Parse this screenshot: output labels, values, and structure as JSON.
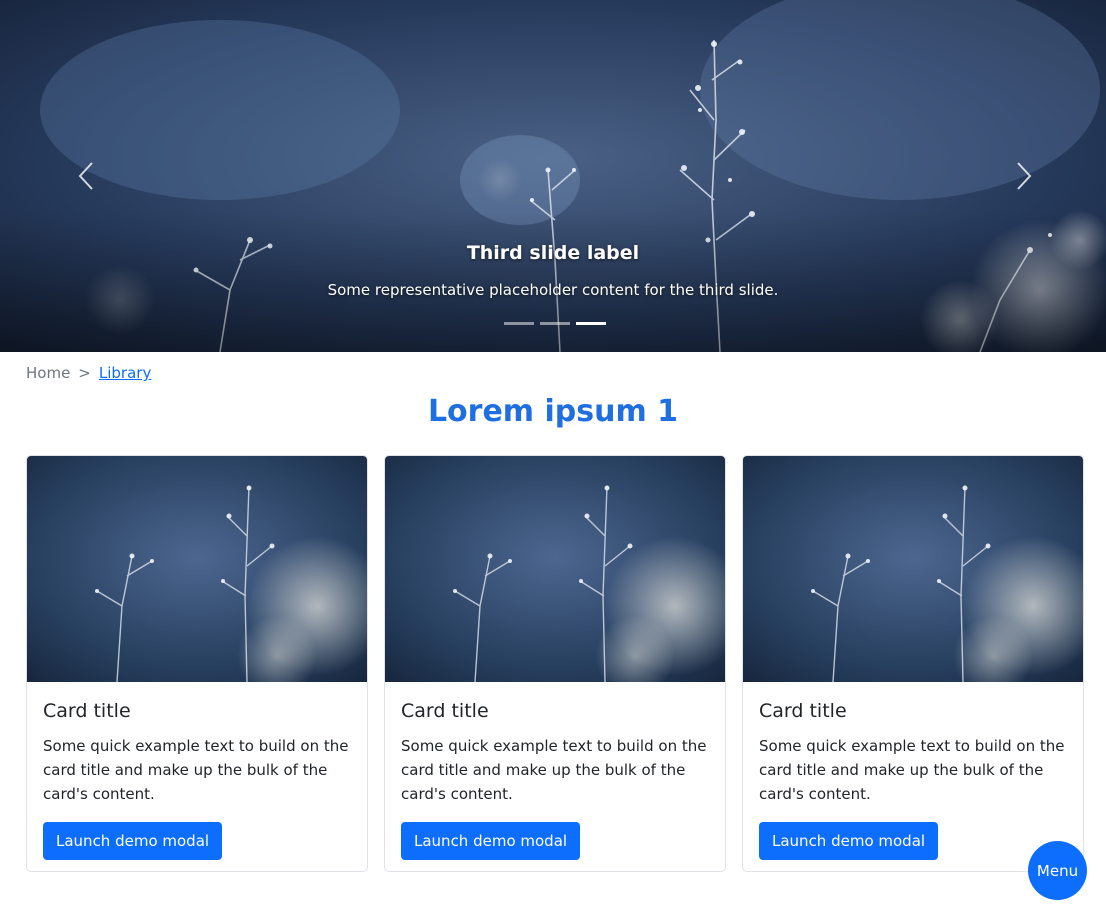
{
  "carousel": {
    "image": "frosted-plants-photo",
    "caption_title": "Third slide label",
    "caption_text": "Some representative placeholder content for the third slide.",
    "prev_icon": "chevron-left-icon",
    "next_icon": "chevron-right-icon",
    "slide_count": 3,
    "active_slide": 3
  },
  "breadcrumb": {
    "items": [
      {
        "label": "Home"
      },
      {
        "label": ">"
      },
      {
        "label": "Library"
      }
    ]
  },
  "main": {
    "title": "Lorem ipsum 1"
  },
  "cards": [
    {
      "image": "frosted-plants-photo",
      "title": "Card title",
      "text": "Some quick example text to build on the card title and make up the bulk of the card's content.",
      "button_label": "Launch demo modal"
    },
    {
      "image": "frosted-plants-photo",
      "title": "Card title",
      "text": "Some quick example text to build on the card title and make up the bulk of the card's content.",
      "button_label": "Launch demo modal"
    },
    {
      "image": "frosted-plants-photo",
      "title": "Card title",
      "text": "Some quick example text to build on the card title and make up the bulk of the card's content.",
      "button_label": "Launch demo modal"
    }
  ],
  "fab": {
    "label": "Menu"
  },
  "colors": {
    "primary": "#0d6efd",
    "title": "#1f6fe0",
    "muted": "#6c757d"
  }
}
